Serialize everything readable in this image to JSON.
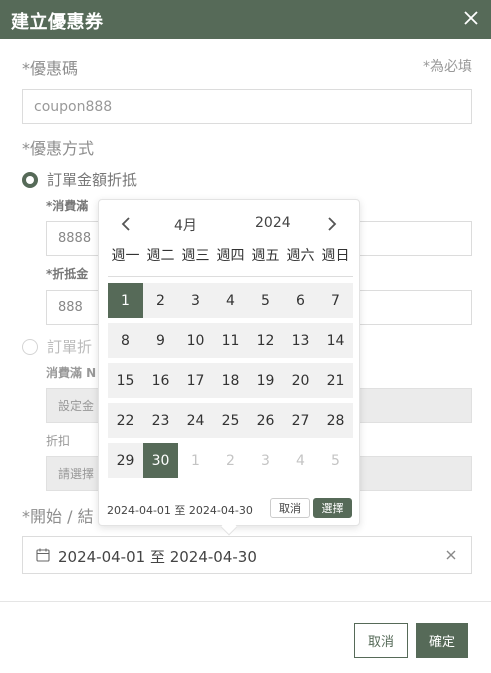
{
  "modal": {
    "title": "建立優惠券"
  },
  "form": {
    "required_note": "*為必填",
    "coupon_code_label": "*優惠碼",
    "coupon_code_value": "coupon888",
    "method_label": "*優惠方式",
    "option1": {
      "label": "訂單金額折抵",
      "threshold_label": "*消費滿",
      "threshold_value": "8888",
      "discount_label": "*折抵金",
      "discount_value": "888"
    },
    "option2": {
      "label": "訂單折",
      "threshold_label": "消費滿 N",
      "threshold_placeholder": "設定金",
      "discount_label": "折扣",
      "discount_placeholder": "請選擇"
    },
    "period_label": "*開始 / 結",
    "period_value": "2024-04-01 至 2024-04-30"
  },
  "datepicker": {
    "month": "4月",
    "year": "2024",
    "weekdays": [
      "週一",
      "週二",
      "週三",
      "週四",
      "週五",
      "週六",
      "週日"
    ],
    "weeks": [
      [
        "1",
        "2",
        "3",
        "4",
        "5",
        "6",
        "7"
      ],
      [
        "8",
        "9",
        "10",
        "11",
        "12",
        "13",
        "14"
      ],
      [
        "15",
        "16",
        "17",
        "18",
        "19",
        "20",
        "21"
      ],
      [
        "22",
        "23",
        "24",
        "25",
        "26",
        "27",
        "28"
      ],
      [
        "29",
        "30",
        "1",
        "2",
        "3",
        "4",
        "5"
      ]
    ],
    "selected_days": [
      "1",
      "30"
    ],
    "range_text": "2024-04-01 至 2024-04-30",
    "cancel_label": "取消",
    "choose_label": "選擇"
  },
  "footer": {
    "cancel_label": "取消",
    "confirm_label": "確定"
  },
  "colors": {
    "brand": "#566a58"
  },
  "icons": [
    "close-icon",
    "calendar-icon",
    "clear-icon",
    "chevron-left-icon",
    "chevron-right-icon"
  ]
}
